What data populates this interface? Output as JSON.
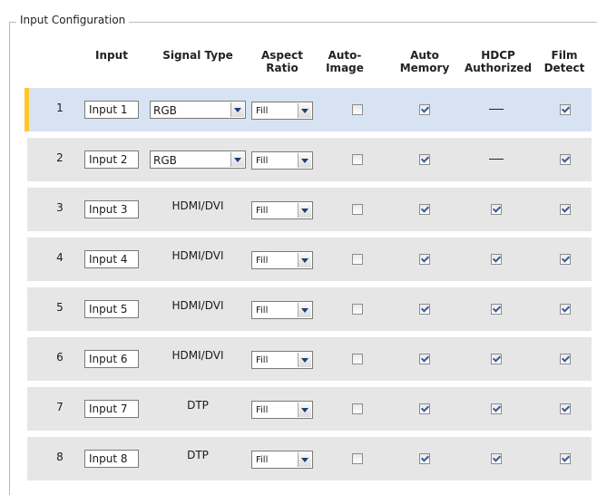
{
  "panel": {
    "title": "Input Configuration"
  },
  "headers": {
    "input": "Input",
    "signal_type": "Signal Type",
    "aspect_ratio": "Aspect\nRatio",
    "auto_image": "Auto-\nImage",
    "auto_memory": "Auto\nMemory",
    "hdcp_authorized": "HDCP\nAuthorized",
    "film_detect": "Film\nDetect"
  },
  "rows": [
    {
      "number": "1",
      "input_name": "Input 1",
      "signal_type": "RGB",
      "signal_editable": true,
      "aspect_ratio": "Fill",
      "auto_image": false,
      "auto_memory": true,
      "hdcp": "—",
      "film_detect": true,
      "selected": true
    },
    {
      "number": "2",
      "input_name": "Input 2",
      "signal_type": "RGB",
      "signal_editable": true,
      "aspect_ratio": "Fill",
      "auto_image": false,
      "auto_memory": true,
      "hdcp": "—",
      "film_detect": true,
      "selected": false
    },
    {
      "number": "3",
      "input_name": "Input 3",
      "signal_type": "HDMI/DVI",
      "signal_editable": false,
      "aspect_ratio": "Fill",
      "auto_image": false,
      "auto_memory": true,
      "hdcp": true,
      "film_detect": true,
      "selected": false
    },
    {
      "number": "4",
      "input_name": "Input 4",
      "signal_type": "HDMI/DVI",
      "signal_editable": false,
      "aspect_ratio": "Fill",
      "auto_image": false,
      "auto_memory": true,
      "hdcp": true,
      "film_detect": true,
      "selected": false
    },
    {
      "number": "5",
      "input_name": "Input 5",
      "signal_type": "HDMI/DVI",
      "signal_editable": false,
      "aspect_ratio": "Fill",
      "auto_image": false,
      "auto_memory": true,
      "hdcp": true,
      "film_detect": true,
      "selected": false
    },
    {
      "number": "6",
      "input_name": "Input 6",
      "signal_type": "HDMI/DVI",
      "signal_editable": false,
      "aspect_ratio": "Fill",
      "auto_image": false,
      "auto_memory": true,
      "hdcp": true,
      "film_detect": true,
      "selected": false
    },
    {
      "number": "7",
      "input_name": "Input 7",
      "signal_type": "DTP",
      "signal_editable": false,
      "aspect_ratio": "Fill",
      "auto_image": false,
      "auto_memory": true,
      "hdcp": true,
      "film_detect": true,
      "selected": false
    },
    {
      "number": "8",
      "input_name": "Input 8",
      "signal_type": "DTP",
      "signal_editable": false,
      "aspect_ratio": "Fill",
      "auto_image": false,
      "auto_memory": true,
      "hdcp": true,
      "film_detect": true,
      "selected": false
    }
  ],
  "colors": {
    "selected_row": "#d7e3f2",
    "row": "#e6e6e6",
    "selection_marker": "#ffc72c"
  },
  "icons": {
    "dropdown": "chevron-down-icon",
    "checkbox": "checkbox-icon"
  }
}
